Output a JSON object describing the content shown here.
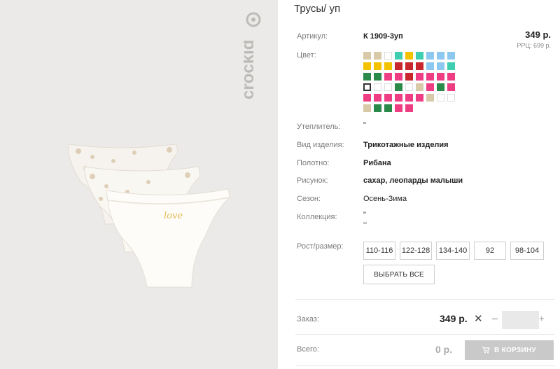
{
  "product": {
    "title": "Трусы/ уп",
    "brand": "crockid"
  },
  "labels": {
    "article": "Артикул:",
    "color": "Цвет:",
    "insulation": "Утеплитель:",
    "kind": "Вид изделия:",
    "fabric": "Полотно:",
    "pattern": "Рисунок:",
    "season": "Сезон:",
    "collection": "Коллекция:",
    "size": "Рост/размер:",
    "order": "Заказ:",
    "total": "Всего:"
  },
  "values": {
    "article": "К 1909-3уп",
    "insulation": "\"",
    "kind": "Трикотажные изделия",
    "fabric": "Рибана",
    "pattern": "сахар, леопарды малыши",
    "season": "Осень-Зима",
    "collection": "\""
  },
  "price": {
    "value": "349 р.",
    "rrp": "РРЦ: 699 р."
  },
  "swatches": [
    "#d8c9a8",
    "#d8c9a8",
    "#ffffff",
    "#3fcfb0",
    "#f3c200",
    "#3fcfb0",
    "#8cc8f0",
    "#8cc8f0",
    "#8cc8f0",
    "#f3c200",
    "#f3c200",
    "#f3c200",
    "#c8282d",
    "#c8282d",
    "#c8282d",
    "#8cc8f0",
    "#8cc8f0",
    "#3fcfb0",
    "#2a8a4a",
    "#2a8a4a",
    "#ee3d83",
    "#ee3d83",
    "#c8282d",
    "#ee3d83",
    "#ee3d83",
    "#ee3d83",
    "#ee3d83",
    "#ffffff",
    "#ffffff",
    "#ffffff",
    "#2a8a4a",
    "#ffffff",
    "#d8c9a8",
    "#ee3d83",
    "#2a8a4a",
    "#ee3d83",
    "#ee3d83",
    "#ee3d83",
    "#ee3d83",
    "#ee3d83",
    "#ee3d83",
    "#ee3d83",
    "#d8c9a8",
    "#ffffff",
    "#ffffff",
    "#d8c9a8",
    "#2a8a4a",
    "#2a8a4a",
    "#ee3d83",
    "#ee3d83"
  ],
  "selected_swatch": 27,
  "sizes": [
    "110-116",
    "122-128",
    "134-140",
    "92",
    "98-104"
  ],
  "select_all": "ВЫБРАТЬ ВСЕ",
  "order": {
    "price": "349 р.",
    "minus": "–",
    "plus": "+",
    "quantity": ""
  },
  "total": {
    "price": "0 р.",
    "cart_button": "В КОРЗИНУ"
  },
  "colors": {
    "background_photo": "#eceae8",
    "cart_button": "#c9c9c9"
  }
}
